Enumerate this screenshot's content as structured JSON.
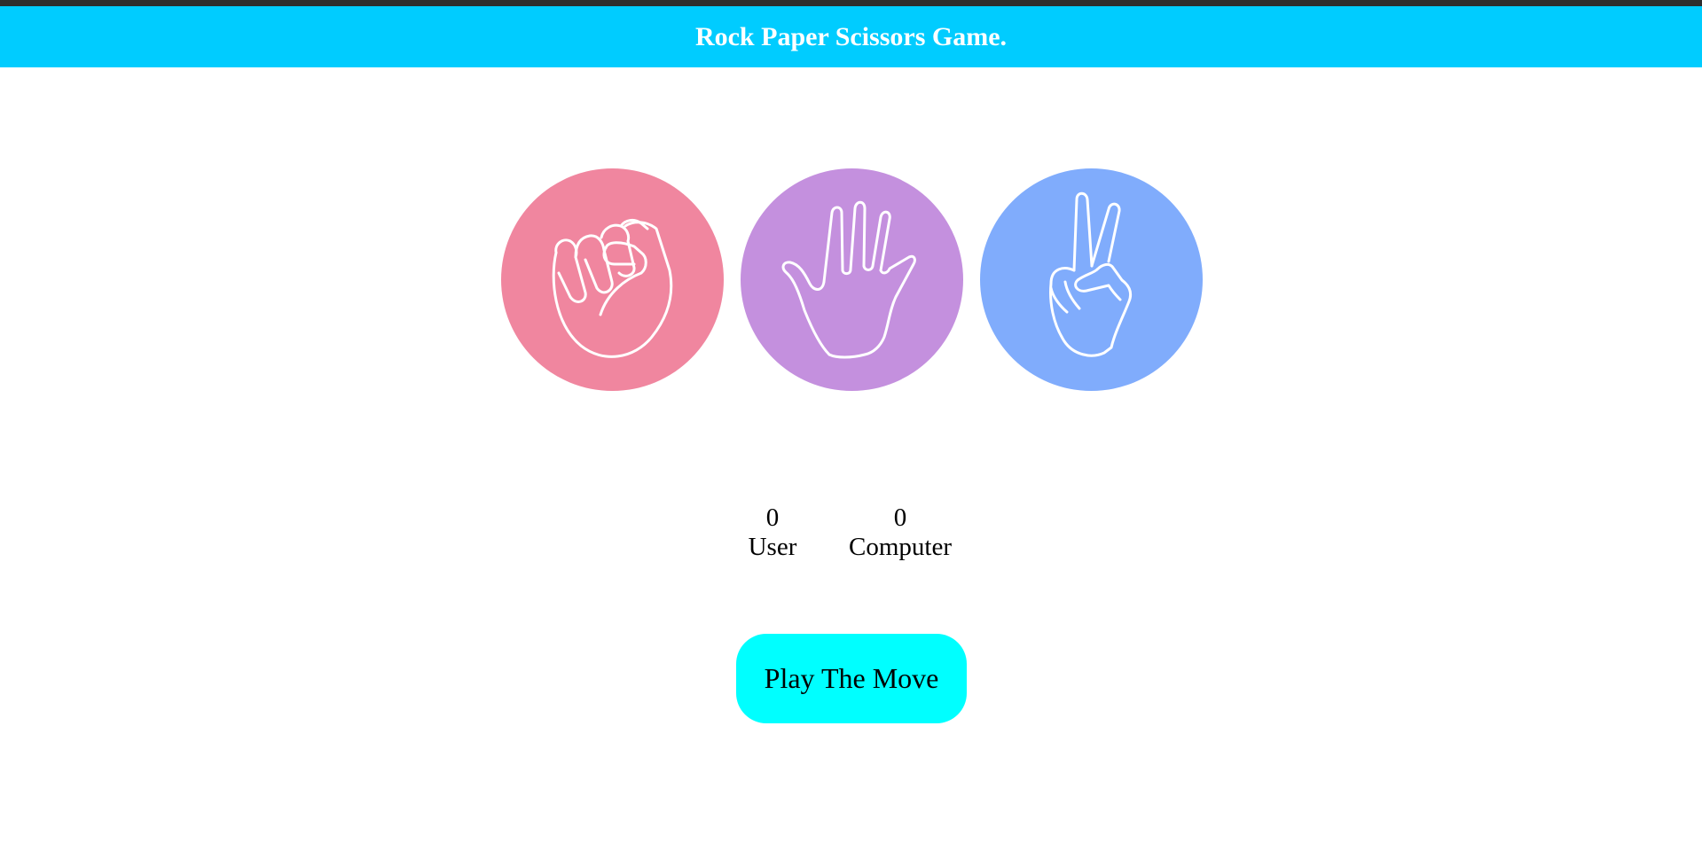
{
  "header": {
    "title": "Rock Paper Scissors Game.",
    "background": "#00ccff"
  },
  "choices": [
    {
      "name": "rock",
      "icon": "fist-icon",
      "color": "#f0869f"
    },
    {
      "name": "paper",
      "icon": "open-hand-icon",
      "color": "#c490de"
    },
    {
      "name": "scissors",
      "icon": "peace-hand-icon",
      "color": "#80acfc"
    }
  ],
  "scoreboard": {
    "user_score": "0",
    "user_label": "User",
    "computer_score": "0",
    "computer_label": "Computer"
  },
  "play_button": {
    "label": "Play The Move",
    "background": "#00ffff"
  }
}
